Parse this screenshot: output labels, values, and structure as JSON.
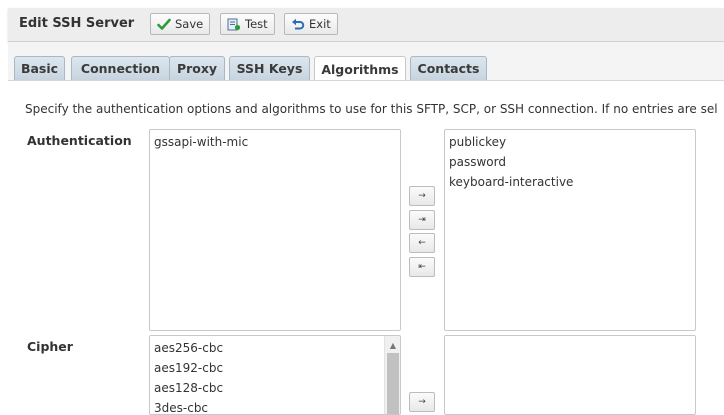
{
  "header": {
    "title": "Edit SSH Server",
    "buttons": [
      {
        "label": "Save",
        "icon": "check-icon"
      },
      {
        "label": "Test",
        "icon": "test-icon"
      },
      {
        "label": "Exit",
        "icon": "undo-icon"
      }
    ]
  },
  "tabs": [
    {
      "label": "Basic",
      "active": false
    },
    {
      "label": "Connection",
      "active": false
    },
    {
      "label": "Proxy",
      "active": false
    },
    {
      "label": "SSH Keys",
      "active": false
    },
    {
      "label": "Algorithms",
      "active": true
    },
    {
      "label": "Contacts",
      "active": false
    }
  ],
  "description": "Specify the authentication options and algorithms to use for this SFTP, SCP, or SSH connection. If no entries are sel",
  "authentication": {
    "label": "Authentication",
    "available": [
      "gssapi-with-mic"
    ],
    "selected": [
      "publickey",
      "password",
      "keyboard-interactive"
    ],
    "controls": [
      "→",
      "⇥",
      "←",
      "⇤"
    ]
  },
  "cipher": {
    "label": "Cipher",
    "available": [
      "aes256-cbc",
      "aes192-cbc",
      "aes128-cbc",
      "3des-cbc"
    ],
    "selected": [],
    "controls": [
      "→"
    ]
  },
  "colors": {
    "accent_green": "#2e9b3a",
    "accent_blue": "#2d6db5",
    "tab_bg": "#c7d4df"
  }
}
